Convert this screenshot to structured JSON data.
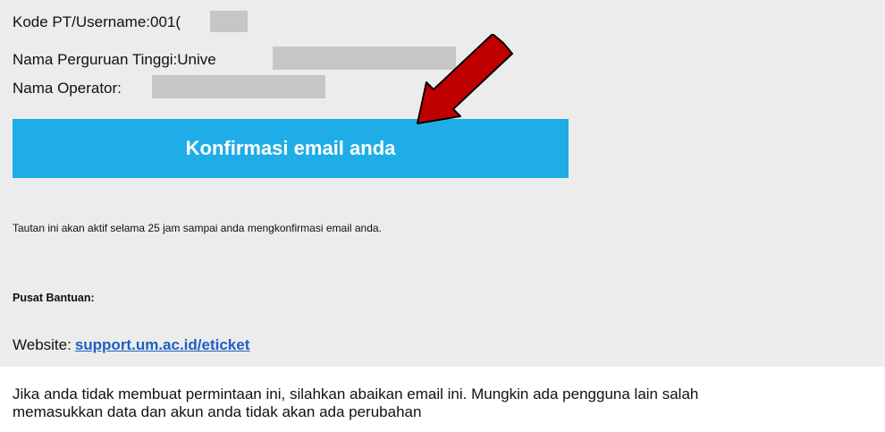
{
  "info": {
    "kode_label": "Kode PT/Username:",
    "kode_value": "001(",
    "nama_pt_label": "Nama Perguruan Tinggi:",
    "nama_pt_value": "Unive",
    "operator_label": "Nama Operator:"
  },
  "cta": {
    "label": "Konfirmasi email anda",
    "color": "#1fade8"
  },
  "notice": "Tautan ini akan aktif selama 25 jam sampai anda mengkonfirmasi email anda.",
  "help": {
    "heading": "Pusat Bantuan:",
    "website_label": "Website:",
    "website_link": "support.um.ac.id/eticket"
  },
  "footer": {
    "line1": "Jika anda tidak membuat permintaan ini, silahkan abaikan email ini. Mungkin ada pengguna lain salah",
    "line2": "memasukkan data dan akun anda tidak akan ada perubahan"
  },
  "annotation": {
    "arrow_color": "#c00000"
  }
}
